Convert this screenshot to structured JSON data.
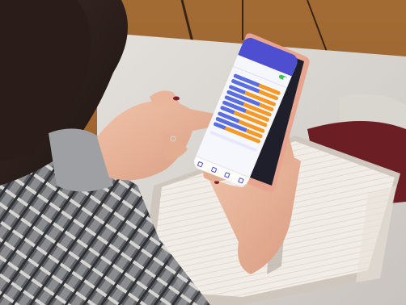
{
  "scene": {
    "description_kind": "photo",
    "colors": {
      "phone_case": "#e7a58f",
      "app_primary": "#4d4fd0",
      "bar_blue": "#5b6ee0",
      "bar_orange": "#f59a28",
      "toggle_on": "#3fbf4f"
    }
  },
  "app": {
    "header_title": "",
    "header_subtitle": "",
    "toggle_label": "",
    "toggle_on": true,
    "tabs": [],
    "section_title": "",
    "hint_text": "",
    "bars": [
      {
        "blue": 0.55,
        "orange": 0.45
      },
      {
        "blue": 0.6,
        "orange": 0.4
      },
      {
        "blue": 0.35,
        "orange": 0.65
      },
      {
        "blue": 0.7,
        "orange": 0.3
      },
      {
        "blue": 0.4,
        "orange": 0.6
      },
      {
        "blue": 0.5,
        "orange": 0.5
      },
      {
        "blue": 0.3,
        "orange": 0.7
      },
      {
        "blue": 0.45,
        "orange": 0.55
      },
      {
        "blue": 0.65,
        "orange": 0.35
      },
      {
        "blue": 0.25,
        "orange": 0.75
      }
    ],
    "nav_icons": [
      "home-icon",
      "calendar-icon",
      "people-icon",
      "settings-icon"
    ]
  }
}
